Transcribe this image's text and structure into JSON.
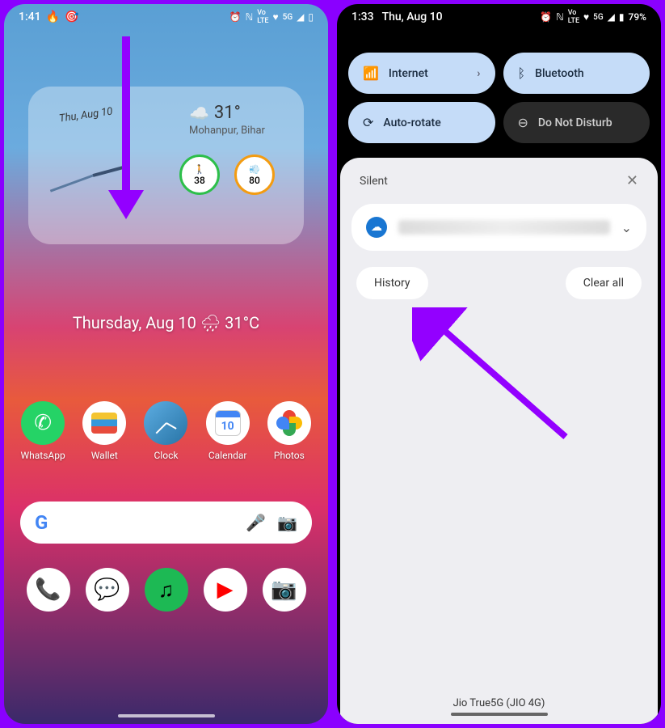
{
  "left": {
    "status": {
      "time": "1:41",
      "icons": [
        "⏰",
        "N",
        "VoLTE",
        "♥",
        "5G",
        "◢",
        "▢"
      ]
    },
    "widget": {
      "date_arc": "Thu, Aug 10",
      "temp": "31°",
      "location": "Mohanpur, Bihar",
      "steps": "38",
      "aqi": "80"
    },
    "date_line": "Thursday, Aug 10 🌧 31°C",
    "apps": [
      {
        "name": "WhatsApp"
      },
      {
        "name": "Wallet"
      },
      {
        "name": "Clock"
      },
      {
        "name": "Calendar",
        "day": "10"
      },
      {
        "name": "Photos"
      }
    ]
  },
  "right": {
    "status": {
      "time": "1:33",
      "date": "Thu, Aug 10",
      "battery": "79%"
    },
    "qs": {
      "internet": "Internet",
      "bluetooth": "Bluetooth",
      "autorotate": "Auto-rotate",
      "dnd": "Do Not Disturb"
    },
    "silent_label": "Silent",
    "history": "History",
    "clear_all": "Clear all",
    "carrier": "Jio True5G (JIO 4G)"
  }
}
